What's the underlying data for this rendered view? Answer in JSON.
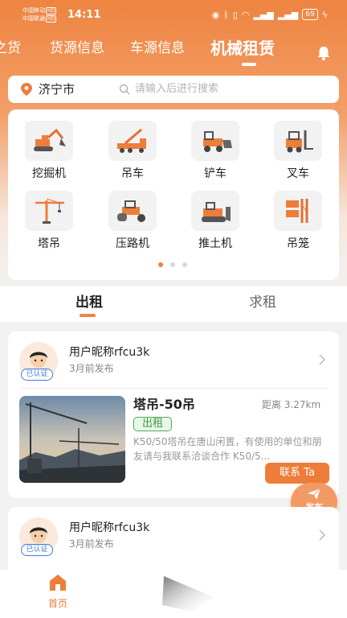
{
  "status_bar": {
    "carrier1": "中国移动",
    "carrier2": "中国联通",
    "carrier_tag": "HD",
    "time": "14:11",
    "battery": "69"
  },
  "top_tabs": [
    "之货",
    "货源信息",
    "车源信息",
    "机械租赁"
  ],
  "search": {
    "city": "济宁市",
    "placeholder": "请输入后进行搜索"
  },
  "categories": [
    {
      "label": "挖掘机",
      "icon": "excavator-icon"
    },
    {
      "label": "吊车",
      "icon": "crane-truck-icon"
    },
    {
      "label": "铲车",
      "icon": "loader-icon"
    },
    {
      "label": "叉车",
      "icon": "forklift-icon"
    },
    {
      "label": "塔吊",
      "icon": "tower-crane-icon"
    },
    {
      "label": "压路机",
      "icon": "road-roller-icon"
    },
    {
      "label": "推土机",
      "icon": "bulldozer-icon"
    },
    {
      "label": "吊笼",
      "icon": "hoist-cage-icon"
    }
  ],
  "sub_tabs": [
    "出租",
    "求租"
  ],
  "listings": [
    {
      "user": "用户昵称rfcu3k",
      "time": "3月前发布",
      "badge": "已认证",
      "title": "塔吊-50吊",
      "distance": "距离 3.27km",
      "tag": "出租",
      "desc": "K50/50塔吊在唐山闲置，有使用的单位和朋友请与我联系洽谈合作 K50/5...",
      "contact": "联系 Ta"
    },
    {
      "user": "用户昵称rfcu3k",
      "time": "3月前发布",
      "badge": "已认证"
    }
  ],
  "fab_label": "发布",
  "bottom_nav": {
    "home": "首页"
  },
  "colors": {
    "accent": "#ee7d3a",
    "verified": "#3d7bd6",
    "tag_green": "#4caf50"
  }
}
